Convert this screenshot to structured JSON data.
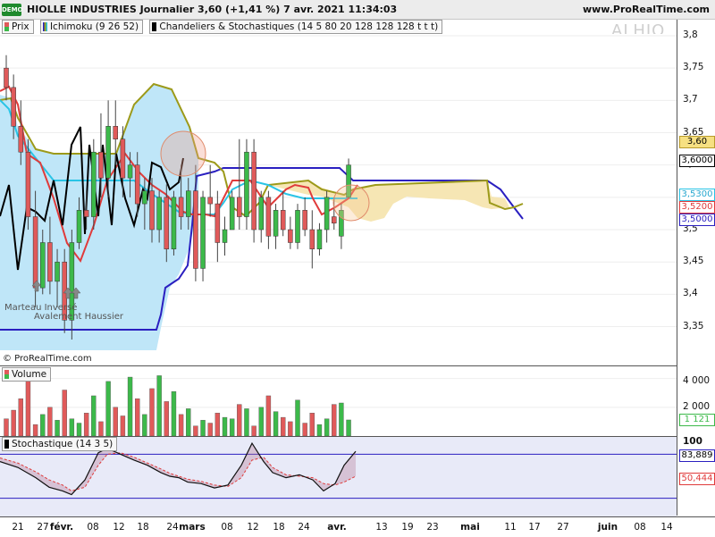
{
  "window": {
    "demo_badge": "DEMO",
    "title": "HIOLLE INDUSTRIES Journalier 3,60 (+1,41 %) 7 avr. 2021 11:34:03",
    "site": "www.ProRealTime.com",
    "watermark": "ALHIO",
    "copyright": "© ProRealTime.com"
  },
  "legend": {
    "prix": "Prix",
    "ichimoku": "Ichimoku (9 26 52)",
    "chandeliers": "Chandeliers & Stochastiques (14 5 80 20 128 128 128 t t t)"
  },
  "annotations": {
    "marteau": "Marteau Inversé",
    "avalement": "Avalement Haussier"
  },
  "price_axis": {
    "ticks": [
      "3,8",
      "3,75",
      "3,7",
      "3,65",
      "3,6",
      "3,55",
      "3,5",
      "3,45",
      "3,4",
      "3,35"
    ],
    "last_price": "3,60",
    "tenkan_value": "3,6000",
    "kijun_value": "3,5300",
    "senkou_value": "3,5200",
    "chikou_value": "3,5000"
  },
  "volume_panel": {
    "title": "Volume",
    "ticks": [
      "4 000",
      "2 000"
    ],
    "current": "1 121"
  },
  "stoch_panel": {
    "title": "Stochastique (14 3 5)",
    "top_tick": "100",
    "k_value": "83,889",
    "d_value": "50,444"
  },
  "date_axis": {
    "labels": [
      "21",
      "27",
      "févr.",
      "08",
      "12",
      "18",
      "24",
      "mars",
      "08",
      "12",
      "18",
      "24",
      "avr.",
      "13",
      "19",
      "23",
      "mai",
      "11",
      "17",
      "27",
      "juin",
      "08",
      "14"
    ]
  },
  "colors": {
    "up_candle": "#3cb94a",
    "down_candle": "#e05a5a",
    "cloud_bull": "#bfe6f8",
    "cloud_bear": "#f6e6b4",
    "tenkan": "#e03b3b",
    "kijun": "#29c4e6",
    "chikou": "#000000",
    "span_b": "#2a1fc0",
    "span_a": "#9c9a1a"
  },
  "chart_data": {
    "type": "candlestick",
    "title": "HIOLLE INDUSTRIES Journalier",
    "y_range": [
      3.3,
      3.8
    ],
    "candles": [
      {
        "o": 3.75,
        "h": 3.77,
        "l": 3.7,
        "c": 3.72
      },
      {
        "o": 3.72,
        "h": 3.74,
        "l": 3.64,
        "c": 3.66
      },
      {
        "o": 3.66,
        "h": 3.7,
        "l": 3.6,
        "c": 3.62
      },
      {
        "o": 3.62,
        "h": 3.64,
        "l": 3.5,
        "c": 3.52
      },
      {
        "o": 3.52,
        "h": 3.56,
        "l": 3.38,
        "c": 3.41
      },
      {
        "o": 3.41,
        "h": 3.5,
        "l": 3.4,
        "c": 3.48
      },
      {
        "o": 3.48,
        "h": 3.52,
        "l": 3.4,
        "c": 3.42
      },
      {
        "o": 3.42,
        "h": 3.47,
        "l": 3.38,
        "c": 3.45
      },
      {
        "o": 3.45,
        "h": 3.47,
        "l": 3.34,
        "c": 3.36
      },
      {
        "o": 3.36,
        "h": 3.5,
        "l": 3.33,
        "c": 3.48
      },
      {
        "o": 3.48,
        "h": 3.55,
        "l": 3.47,
        "c": 3.53
      },
      {
        "o": 3.53,
        "h": 3.56,
        "l": 3.5,
        "c": 3.52
      },
      {
        "o": 3.52,
        "h": 3.64,
        "l": 3.5,
        "c": 3.62
      },
      {
        "o": 3.62,
        "h": 3.68,
        "l": 3.55,
        "c": 3.58
      },
      {
        "o": 3.58,
        "h": 3.7,
        "l": 3.55,
        "c": 3.66
      },
      {
        "o": 3.66,
        "h": 3.7,
        "l": 3.6,
        "c": 3.64
      },
      {
        "o": 3.64,
        "h": 3.66,
        "l": 3.55,
        "c": 3.58
      },
      {
        "o": 3.58,
        "h": 3.62,
        "l": 3.55,
        "c": 3.6
      },
      {
        "o": 3.6,
        "h": 3.62,
        "l": 3.52,
        "c": 3.54
      },
      {
        "o": 3.54,
        "h": 3.58,
        "l": 3.5,
        "c": 3.56
      },
      {
        "o": 3.56,
        "h": 3.58,
        "l": 3.48,
        "c": 3.5
      },
      {
        "o": 3.5,
        "h": 3.56,
        "l": 3.48,
        "c": 3.55
      },
      {
        "o": 3.55,
        "h": 3.57,
        "l": 3.45,
        "c": 3.47
      },
      {
        "o": 3.47,
        "h": 3.56,
        "l": 3.46,
        "c": 3.55
      },
      {
        "o": 3.55,
        "h": 3.6,
        "l": 3.5,
        "c": 3.52
      },
      {
        "o": 3.52,
        "h": 3.58,
        "l": 3.5,
        "c": 3.56
      },
      {
        "o": 3.56,
        "h": 3.6,
        "l": 3.42,
        "c": 3.44
      },
      {
        "o": 3.44,
        "h": 3.56,
        "l": 3.42,
        "c": 3.55
      },
      {
        "o": 3.55,
        "h": 3.6,
        "l": 3.52,
        "c": 3.54
      },
      {
        "o": 3.54,
        "h": 3.56,
        "l": 3.45,
        "c": 3.48
      },
      {
        "o": 3.48,
        "h": 3.52,
        "l": 3.46,
        "c": 3.5
      },
      {
        "o": 3.5,
        "h": 3.56,
        "l": 3.5,
        "c": 3.55
      },
      {
        "o": 3.55,
        "h": 3.64,
        "l": 3.5,
        "c": 3.52
      },
      {
        "o": 3.52,
        "h": 3.64,
        "l": 3.5,
        "c": 3.62
      },
      {
        "o": 3.62,
        "h": 3.64,
        "l": 3.48,
        "c": 3.5
      },
      {
        "o": 3.5,
        "h": 3.56,
        "l": 3.48,
        "c": 3.55
      },
      {
        "o": 3.55,
        "h": 3.56,
        "l": 3.47,
        "c": 3.49
      },
      {
        "o": 3.49,
        "h": 3.54,
        "l": 3.47,
        "c": 3.53
      },
      {
        "o": 3.53,
        "h": 3.56,
        "l": 3.49,
        "c": 3.5
      },
      {
        "o": 3.5,
        "h": 3.52,
        "l": 3.47,
        "c": 3.48
      },
      {
        "o": 3.48,
        "h": 3.54,
        "l": 3.47,
        "c": 3.53
      },
      {
        "o": 3.53,
        "h": 3.55,
        "l": 3.49,
        "c": 3.5
      },
      {
        "o": 3.5,
        "h": 3.53,
        "l": 3.44,
        "c": 3.47
      },
      {
        "o": 3.47,
        "h": 3.51,
        "l": 3.46,
        "c": 3.5
      },
      {
        "o": 3.5,
        "h": 3.56,
        "l": 3.48,
        "c": 3.55
      },
      {
        "o": 3.52,
        "h": 3.55,
        "l": 3.5,
        "c": 3.51
      },
      {
        "o": 3.49,
        "h": 3.54,
        "l": 3.47,
        "c": 3.53
      },
      {
        "o": 3.55,
        "h": 3.61,
        "l": 3.55,
        "c": 3.6
      }
    ],
    "volumes": [
      1200,
      1800,
      2600,
      4300,
      800,
      1500,
      2000,
      1100,
      3200,
      1200,
      900,
      1600,
      2800,
      1000,
      3800,
      2000,
      1400,
      4100,
      2600,
      1500,
      3300,
      4200,
      2400,
      3100,
      1500,
      1900,
      700,
      1100,
      900,
      1600,
      1300,
      1200,
      2200,
      1900,
      700,
      2000,
      2800,
      1700,
      1300,
      1000,
      2500,
      900,
      1600,
      800,
      1200,
      2200,
      2300,
      1121
    ],
    "stochastic": {
      "k_last": 83.889,
      "d_last": 50.444,
      "range": [
        0,
        100
      ],
      "levels": [
        80,
        20
      ]
    }
  }
}
